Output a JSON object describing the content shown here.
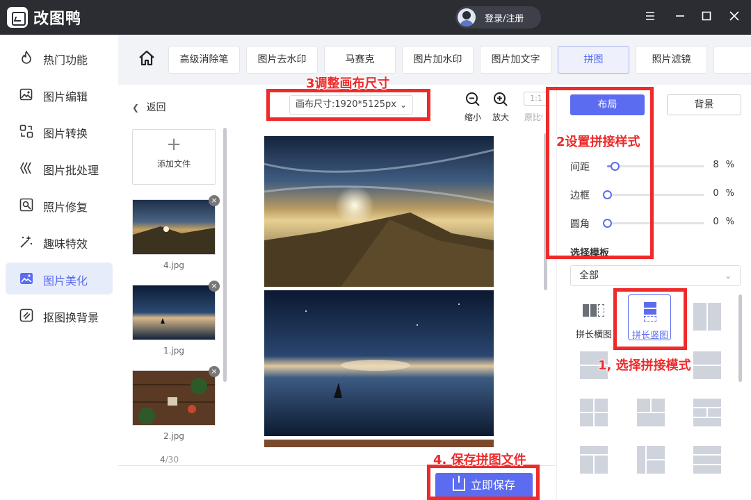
{
  "app": {
    "name": "改图鸭",
    "login_label": "登录/注册"
  },
  "sidebar": {
    "items": [
      {
        "label": "热门功能",
        "icon": "flame-icon"
      },
      {
        "label": "图片编辑",
        "icon": "image-edit-icon"
      },
      {
        "label": "图片转换",
        "icon": "convert-icon"
      },
      {
        "label": "图片批处理",
        "icon": "batch-icon"
      },
      {
        "label": "照片修复",
        "icon": "photo-repair-icon"
      },
      {
        "label": "趣味特效",
        "icon": "magic-wand-icon"
      },
      {
        "label": "图片美化",
        "icon": "beautify-icon",
        "active": true
      },
      {
        "label": "抠图换背景",
        "icon": "cutout-icon"
      }
    ]
  },
  "nav": {
    "tabs": [
      "高级消除笔",
      "图片去水印",
      "马赛克",
      "图片加水印",
      "图片加文字",
      "拼图",
      "照片滤镜"
    ],
    "active": "拼图"
  },
  "toolbar": {
    "back_label": "返回",
    "canvas_size": "画布尺寸:1920*5125px",
    "zoom_out": "缩小",
    "zoom_in": "放大",
    "ratio": "1:1",
    "ratio_label": "原比例"
  },
  "files": {
    "add_label": "添加文件",
    "items": [
      {
        "name": "4.jpg"
      },
      {
        "name": "1.jpg"
      },
      {
        "name": "2.jpg"
      }
    ],
    "count_current": "4",
    "count_total": "/30"
  },
  "save_label": "立即保存",
  "right_panel": {
    "tabs": [
      "布局",
      "背景"
    ],
    "sliders": [
      {
        "label": "间距",
        "value": "8",
        "unit": "%",
        "level": 0.08
      },
      {
        "label": "边框",
        "value": "0",
        "unit": "%",
        "level": 0
      },
      {
        "label": "圆角",
        "value": "0",
        "unit": "%",
        "level": 0
      }
    ],
    "template_heading": "选择模板",
    "template_filter": "全部",
    "templates": [
      {
        "label": "拼长横图"
      },
      {
        "label": "拼长竖图",
        "selected": true
      }
    ]
  },
  "annotations": {
    "a1": "1, 选择拼接模式",
    "a2": "2设置拼接样式",
    "a3": "3调整画布尺寸",
    "a4": "4. 保存拼图文件"
  },
  "colors": {
    "accent": "#5b6cf0",
    "annotation": "#ee2a2a",
    "titlebar": "#2b2d33"
  }
}
